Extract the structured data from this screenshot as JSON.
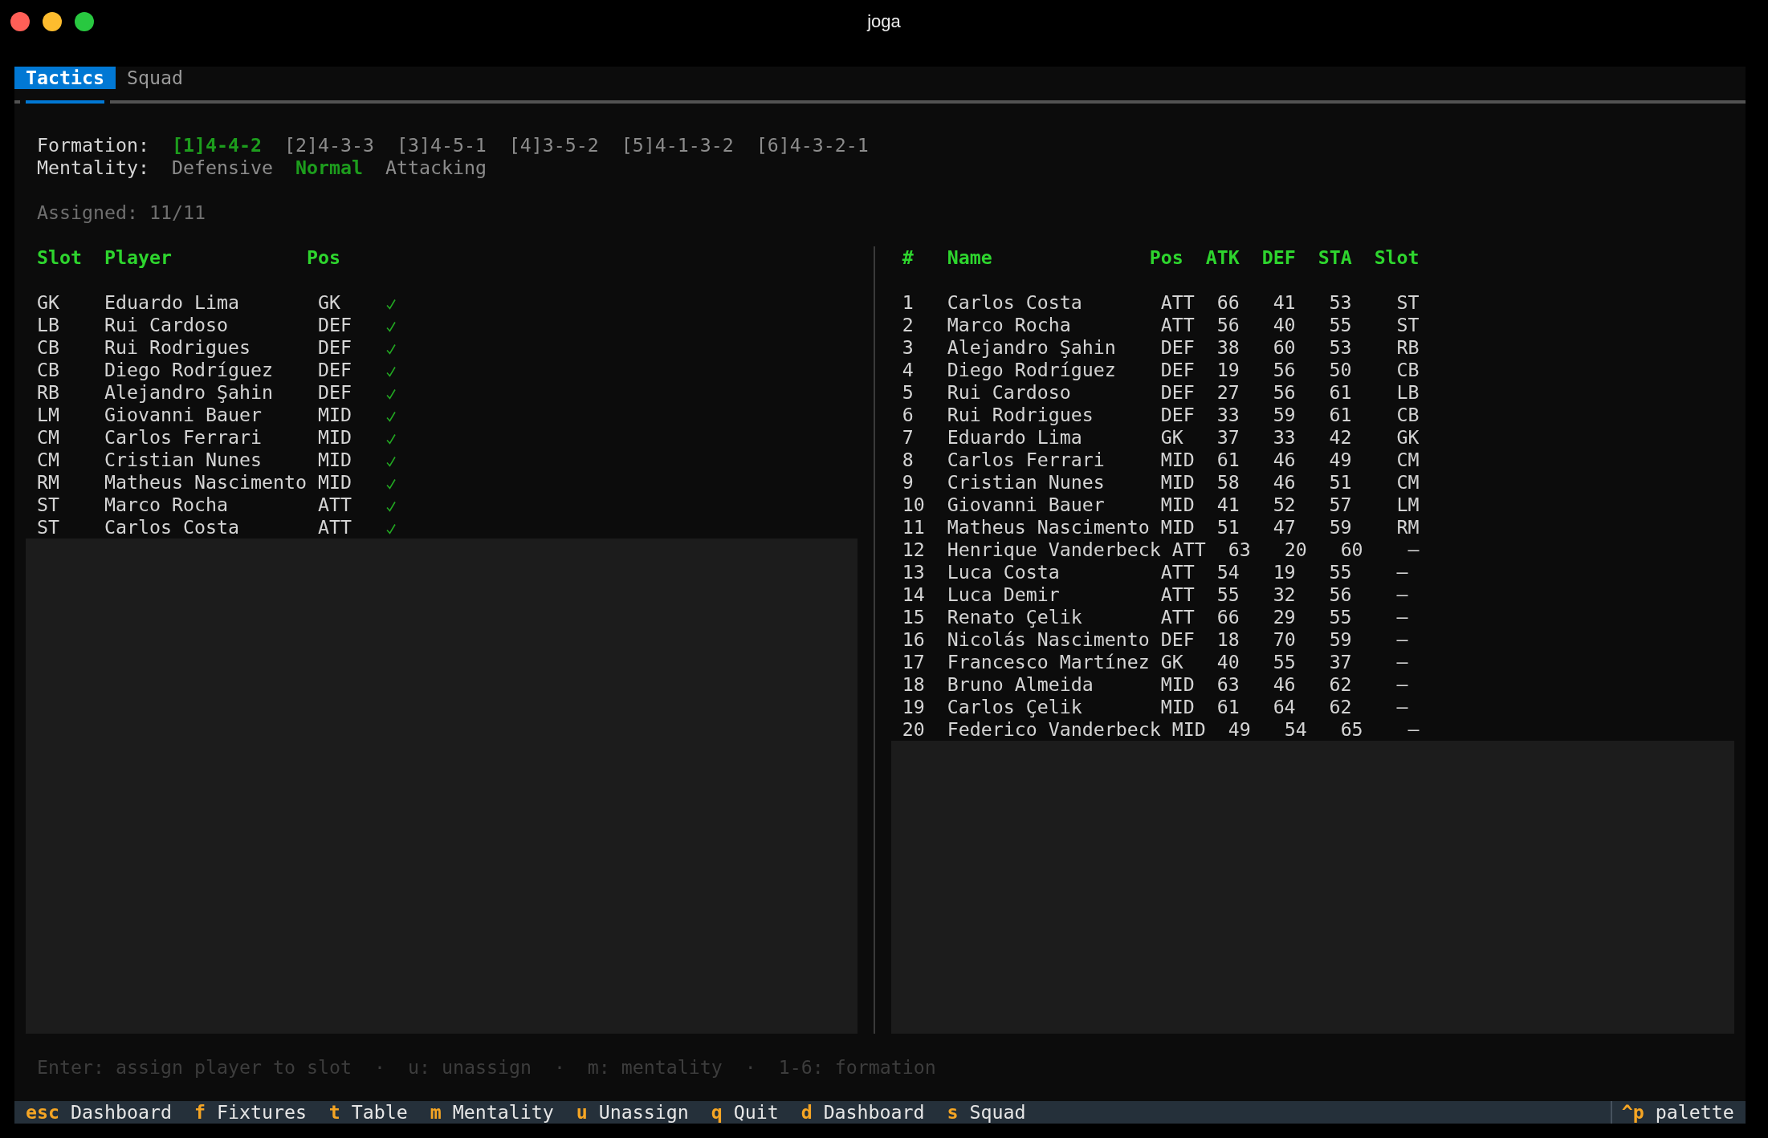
{
  "window": {
    "title": "joga"
  },
  "tabs": [
    {
      "label": "Tactics",
      "selected": true
    },
    {
      "label": "Squad",
      "selected": false
    }
  ],
  "formation": {
    "label": "Formation:",
    "options": [
      {
        "label": "[1]4-4-2",
        "selected": true
      },
      {
        "label": "[2]4-3-3",
        "selected": false
      },
      {
        "label": "[3]4-5-1",
        "selected": false
      },
      {
        "label": "[4]3-5-2",
        "selected": false
      },
      {
        "label": "[5]4-1-3-2",
        "selected": false
      },
      {
        "label": "[6]4-3-2-1",
        "selected": false
      }
    ]
  },
  "mentality": {
    "label": "Mentality:",
    "options": [
      {
        "label": "Defensive",
        "selected": false
      },
      {
        "label": "Normal",
        "selected": true
      },
      {
        "label": "Attacking",
        "selected": false
      }
    ]
  },
  "assigned": "Assigned: 11/11",
  "lineup": {
    "columns": [
      "Slot",
      "Player",
      "Pos"
    ],
    "rows": [
      {
        "slot": "GK",
        "player": "Eduardo Lima",
        "pos": "GK",
        "assigned": true
      },
      {
        "slot": "LB",
        "player": "Rui Cardoso",
        "pos": "DEF",
        "assigned": true
      },
      {
        "slot": "CB",
        "player": "Rui Rodrigues",
        "pos": "DEF",
        "assigned": true
      },
      {
        "slot": "CB",
        "player": "Diego Rodríguez",
        "pos": "DEF",
        "assigned": true
      },
      {
        "slot": "RB",
        "player": "Alejandro Şahin",
        "pos": "DEF",
        "assigned": true
      },
      {
        "slot": "LM",
        "player": "Giovanni Bauer",
        "pos": "MID",
        "assigned": true
      },
      {
        "slot": "CM",
        "player": "Carlos Ferrari",
        "pos": "MID",
        "assigned": true
      },
      {
        "slot": "CM",
        "player": "Cristian Nunes",
        "pos": "MID",
        "assigned": true
      },
      {
        "slot": "RM",
        "player": "Matheus Nascimento",
        "pos": "MID",
        "assigned": true
      },
      {
        "slot": "ST",
        "player": "Marco Rocha",
        "pos": "ATT",
        "assigned": true
      },
      {
        "slot": "ST",
        "player": "Carlos Costa",
        "pos": "ATT",
        "assigned": true
      }
    ]
  },
  "squad": {
    "columns": [
      "#",
      "Name",
      "Pos",
      "ATK",
      "DEF",
      "STA",
      "Slot"
    ],
    "rows": [
      {
        "number": "1",
        "name": "Carlos Costa",
        "pos": "ATT",
        "atk": "66",
        "def": "41",
        "sta": "53",
        "slot": "ST"
      },
      {
        "number": "2",
        "name": "Marco Rocha",
        "pos": "ATT",
        "atk": "56",
        "def": "40",
        "sta": "55",
        "slot": "ST"
      },
      {
        "number": "3",
        "name": "Alejandro Şahin",
        "pos": "DEF",
        "atk": "38",
        "def": "60",
        "sta": "53",
        "slot": "RB"
      },
      {
        "number": "4",
        "name": "Diego Rodríguez",
        "pos": "DEF",
        "atk": "19",
        "def": "56",
        "sta": "50",
        "slot": "CB"
      },
      {
        "number": "5",
        "name": "Rui Cardoso",
        "pos": "DEF",
        "atk": "27",
        "def": "56",
        "sta": "61",
        "slot": "LB"
      },
      {
        "number": "6",
        "name": "Rui Rodrigues",
        "pos": "DEF",
        "atk": "33",
        "def": "59",
        "sta": "61",
        "slot": "CB"
      },
      {
        "number": "7",
        "name": "Eduardo Lima",
        "pos": "GK",
        "atk": "37",
        "def": "33",
        "sta": "42",
        "slot": "GK"
      },
      {
        "number": "8",
        "name": "Carlos Ferrari",
        "pos": "MID",
        "atk": "61",
        "def": "46",
        "sta": "49",
        "slot": "CM"
      },
      {
        "number": "9",
        "name": "Cristian Nunes",
        "pos": "MID",
        "atk": "58",
        "def": "46",
        "sta": "51",
        "slot": "CM"
      },
      {
        "number": "10",
        "name": "Giovanni Bauer",
        "pos": "MID",
        "atk": "41",
        "def": "52",
        "sta": "57",
        "slot": "LM"
      },
      {
        "number": "11",
        "name": "Matheus Nascimento",
        "pos": "MID",
        "atk": "51",
        "def": "47",
        "sta": "59",
        "slot": "RM"
      },
      {
        "number": "12",
        "name": "Henrique Vanderbeck",
        "pos": "ATT",
        "atk": "63",
        "def": "20",
        "sta": "60",
        "slot": "—"
      },
      {
        "number": "13",
        "name": "Luca Costa",
        "pos": "ATT",
        "atk": "54",
        "def": "19",
        "sta": "55",
        "slot": "—"
      },
      {
        "number": "14",
        "name": "Luca Demir",
        "pos": "ATT",
        "atk": "55",
        "def": "32",
        "sta": "56",
        "slot": "—"
      },
      {
        "number": "15",
        "name": "Renato Çelik",
        "pos": "ATT",
        "atk": "66",
        "def": "29",
        "sta": "55",
        "slot": "—"
      },
      {
        "number": "16",
        "name": "Nicolás Nascimento",
        "pos": "DEF",
        "atk": "18",
        "def": "70",
        "sta": "59",
        "slot": "—"
      },
      {
        "number": "17",
        "name": "Francesco Martínez",
        "pos": "GK",
        "atk": "40",
        "def": "55",
        "sta": "37",
        "slot": "—"
      },
      {
        "number": "18",
        "name": "Bruno Almeida",
        "pos": "MID",
        "atk": "63",
        "def": "46",
        "sta": "62",
        "slot": "—"
      },
      {
        "number": "19",
        "name": "Carlos Çelik",
        "pos": "MID",
        "atk": "61",
        "def": "64",
        "sta": "62",
        "slot": "—"
      },
      {
        "number": "20",
        "name": "Federico Vanderbeck",
        "pos": "MID",
        "atk": "49",
        "def": "54",
        "sta": "65",
        "slot": "—"
      }
    ]
  },
  "hint": "Enter: assign player to slot  ·  u: unassign  ·  m: mentality  ·  1-6: formation",
  "status_bar": {
    "bindings": [
      {
        "key": "esc",
        "label": "Dashboard"
      },
      {
        "key": "f",
        "label": "Fixtures"
      },
      {
        "key": "t",
        "label": "Table"
      },
      {
        "key": "m",
        "label": "Mentality"
      },
      {
        "key": "u",
        "label": "Unassign"
      },
      {
        "key": "q",
        "label": "Quit"
      },
      {
        "key": "d",
        "label": "Dashboard"
      },
      {
        "key": "s",
        "label": "Squad"
      }
    ],
    "palette": {
      "key": "^p",
      "label": "palette"
    }
  }
}
